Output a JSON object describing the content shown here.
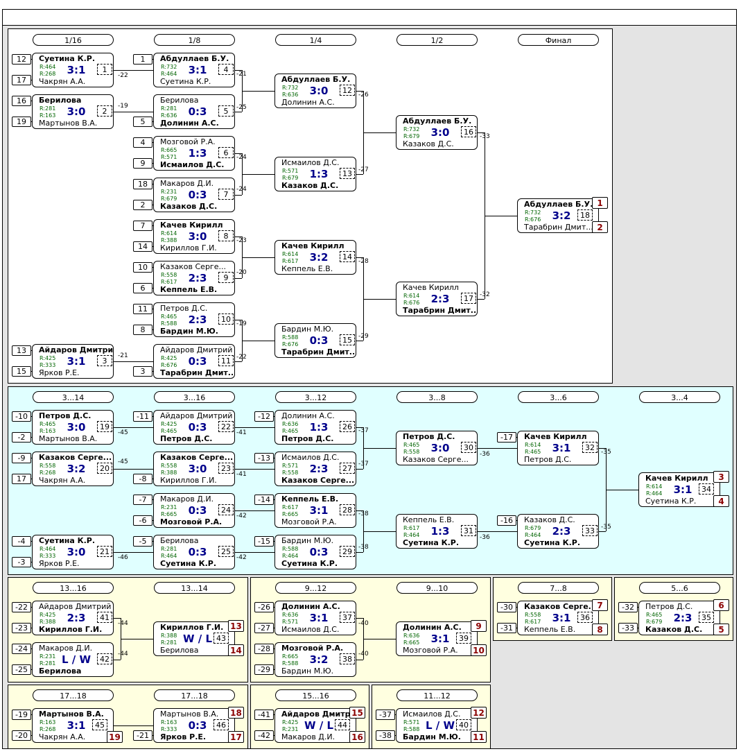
{
  "rounds": {
    "r16": "1/16",
    "r8": "1/8",
    "r4": "1/4",
    "r2": "1/2",
    "final": "Финал",
    "c3_14": "3...14",
    "c3_16": "3...16",
    "c3_12": "3...12",
    "c3_8": "3...8",
    "c3_6": "3...6",
    "c3_4": "3...4",
    "c13_16": "13...16",
    "c13_14": "13...14",
    "c9_12": "9...12",
    "c9_10": "9...10",
    "c7_8": "7...8",
    "c5_6": "5...6",
    "c17_18a": "17...18",
    "c17_18b": "17...18",
    "c15_16": "15...16",
    "c11_12": "11...12"
  },
  "matches": [
    {
      "id": "m1",
      "p1": "Суетина К.Р.",
      "r1": "R:464",
      "p2": "Чакрян А.А.",
      "r2": "R:268",
      "score": "3:1",
      "num": "1",
      "win": 1
    },
    {
      "id": "m2",
      "p1": "Берилова",
      "r1": "R:281",
      "p2": "Мартынов В.А.",
      "r2": "R:163",
      "score": "3:0",
      "num": "2",
      "win": 1
    },
    {
      "id": "m3",
      "p1": "Айдаров Дмитрий",
      "r1": "R:425",
      "p2": "Ярков Р.Е.",
      "r2": "R:333",
      "score": "3:1",
      "num": "3",
      "win": 1
    },
    {
      "id": "m4",
      "p1": "Абдуллаев Б.У.",
      "r1": "R:732",
      "p2": "Суетина К.Р.",
      "r2": "R:464",
      "score": "3:1",
      "num": "4",
      "win": 1
    },
    {
      "id": "m5",
      "p1": "Берилова",
      "r1": "R:281",
      "p2": "Долинин А.С.",
      "r2": "R:636",
      "score": "0:3",
      "num": "5",
      "win": 2
    },
    {
      "id": "m6",
      "p1": "Мозговой Р.А.",
      "r1": "R:665",
      "p2": "Исмаилов Д.С.",
      "r2": "R:571",
      "score": "1:3",
      "num": "6",
      "win": 2
    },
    {
      "id": "m7",
      "p1": "Макаров Д.И.",
      "r1": "R:231",
      "p2": "Казаков Д.С.",
      "r2": "R:679",
      "score": "0:3",
      "num": "7",
      "win": 2
    },
    {
      "id": "m8",
      "p1": "Качев Кирилл",
      "r1": "R:614",
      "p2": "Кириллов Г.И.",
      "r2": "R:388",
      "score": "3:0",
      "num": "8",
      "win": 1
    },
    {
      "id": "m9",
      "p1": "Казаков Серге...",
      "r1": "R:558",
      "p2": "Кеппель Е.В.",
      "r2": "R:617",
      "score": "2:3",
      "num": "9",
      "win": 2
    },
    {
      "id": "m10",
      "p1": "Петров Д.С.",
      "r1": "R:465",
      "p2": "Бардин М.Ю.",
      "r2": "R:588",
      "score": "2:3",
      "num": "10",
      "win": 2
    },
    {
      "id": "m11",
      "p1": "Айдаров Дмитрий",
      "r1": "R:425",
      "p2": "Тарабрин Дмит...",
      "r2": "R:676",
      "score": "0:3",
      "num": "11",
      "win": 2
    },
    {
      "id": "m12",
      "p1": "Абдуллаев Б.У.",
      "r1": "R:732",
      "p2": "Долинин А.С.",
      "r2": "R:636",
      "score": "3:0",
      "num": "12",
      "win": 1
    },
    {
      "id": "m13",
      "p1": "Исмаилов Д.С.",
      "r1": "R:571",
      "p2": "Казаков Д.С.",
      "r2": "R:679",
      "score": "1:3",
      "num": "13",
      "win": 2
    },
    {
      "id": "m14",
      "p1": "Качев Кирилл",
      "r1": "R:614",
      "p2": "Кеппель Е.В.",
      "r2": "R:617",
      "score": "3:2",
      "num": "14",
      "win": 1
    },
    {
      "id": "m15",
      "p1": "Бардин М.Ю.",
      "r1": "R:588",
      "p2": "Тарабрин Дмит...",
      "r2": "R:676",
      "score": "0:3",
      "num": "15",
      "win": 2
    },
    {
      "id": "m16",
      "p1": "Абдуллаев Б.У.",
      "r1": "R:732",
      "p2": "Казаков Д.С.",
      "r2": "R:679",
      "score": "3:0",
      "num": "16",
      "win": 1
    },
    {
      "id": "m17",
      "p1": "Качев Кирилл",
      "r1": "R:614",
      "p2": "Тарабрин Дмит...",
      "r2": "R:676",
      "score": "2:3",
      "num": "17",
      "win": 2
    },
    {
      "id": "m18",
      "p1": "Абдуллаев Б.У.",
      "r1": "R:732",
      "p2": "Тарабрин Дмит...",
      "r2": "R:676",
      "score": "3:2",
      "num": "18",
      "win": 1,
      "pl1": "1",
      "pl2": "2"
    },
    {
      "id": "m19",
      "p1": "Петров Д.С.",
      "r1": "R:465",
      "p2": "Мартынов В.А.",
      "r2": "R:163",
      "score": "3:0",
      "num": "19",
      "win": 1
    },
    {
      "id": "m20",
      "p1": "Казаков Серге...",
      "r1": "R:558",
      "p2": "Чакрян А.А.",
      "r2": "R:268",
      "score": "3:2",
      "num": "20",
      "win": 1
    },
    {
      "id": "m21",
      "p1": "Суетина К.Р.",
      "r1": "R:464",
      "p2": "Ярков Р.Е.",
      "r2": "R:333",
      "score": "3:0",
      "num": "21",
      "win": 1
    },
    {
      "id": "m22",
      "p1": "Айдаров Дмитрий",
      "r1": "R:425",
      "p2": "Петров Д.С.",
      "r2": "R:465",
      "score": "0:3",
      "num": "22",
      "win": 2
    },
    {
      "id": "m23",
      "p1": "Казаков Серге...",
      "r1": "R:558",
      "p2": "Кириллов Г.И.",
      "r2": "R:388",
      "score": "3:0",
      "num": "23",
      "win": 1
    },
    {
      "id": "m24",
      "p1": "Макаров Д.И.",
      "r1": "R:231",
      "p2": "Мозговой Р.А.",
      "r2": "R:665",
      "score": "0:3",
      "num": "24",
      "win": 2
    },
    {
      "id": "m25",
      "p1": "Берилова",
      "r1": "R:281",
      "p2": "Суетина К.Р.",
      "r2": "R:464",
      "score": "0:3",
      "num": "25",
      "win": 2
    },
    {
      "id": "m26",
      "p1": "Долинин А.С.",
      "r1": "R:636",
      "p2": "Петров Д.С.",
      "r2": "R:465",
      "score": "1:3",
      "num": "26",
      "win": 2
    },
    {
      "id": "m27",
      "p1": "Исмаилов Д.С.",
      "r1": "R:571",
      "p2": "Казаков Серге...",
      "r2": "R:558",
      "score": "2:3",
      "num": "27",
      "win": 2
    },
    {
      "id": "m28",
      "p1": "Кеппель Е.В.",
      "r1": "R:617",
      "p2": "Мозговой Р.А.",
      "r2": "R:665",
      "score": "3:1",
      "num": "28",
      "win": 1
    },
    {
      "id": "m29",
      "p1": "Бардин М.Ю.",
      "r1": "R:588",
      "p2": "Суетина К.Р.",
      "r2": "R:464",
      "score": "0:3",
      "num": "29",
      "win": 2
    },
    {
      "id": "m30",
      "p1": "Петров Д.С.",
      "r1": "R:465",
      "p2": "Казаков Серге...",
      "r2": "R:558",
      "score": "3:0",
      "num": "30",
      "win": 1
    },
    {
      "id": "m31",
      "p1": "Кеппель Е.В.",
      "r1": "R:617",
      "p2": "Суетина К.Р.",
      "r2": "R:464",
      "score": "1:3",
      "num": "31",
      "win": 2
    },
    {
      "id": "m32",
      "p1": "Качев Кирилл",
      "r1": "R:614",
      "p2": "Петров Д.С.",
      "r2": "R:465",
      "score": "3:1",
      "num": "32",
      "win": 1
    },
    {
      "id": "m33",
      "p1": "Казаков Д.С.",
      "r1": "R:679",
      "p2": "Суетина К.Р.",
      "r2": "R:464",
      "score": "2:3",
      "num": "33",
      "win": 2
    },
    {
      "id": "m34",
      "p1": "Качев Кирилл",
      "r1": "R:614",
      "p2": "Суетина К.Р.",
      "r2": "R:464",
      "score": "3:1",
      "num": "34",
      "win": 1,
      "pl1": "3",
      "pl2": "4"
    },
    {
      "id": "m41",
      "p1": "Айдаров Дмитрий",
      "r1": "R:425",
      "p2": "Кириллов Г.И.",
      "r2": "R:388",
      "score": "2:3",
      "num": "41",
      "win": 2
    },
    {
      "id": "m42",
      "p1": "Макаров Д.И.",
      "r1": "R:231",
      "p2": "Берилова",
      "r2": "R:281",
      "score": "L / W",
      "num": "42",
      "win": 2
    },
    {
      "id": "m43",
      "p1": "Кириллов Г.И.",
      "r1": "R:388",
      "p2": "Берилова",
      "r2": "R:281",
      "score": "W / L",
      "num": "43",
      "win": 1,
      "pl1": "13",
      "pl2": "14"
    },
    {
      "id": "m37",
      "p1": "Долинин А.С.",
      "r1": "R:636",
      "p2": "Исмаилов Д.С.",
      "r2": "R:571",
      "score": "3:1",
      "num": "37",
      "win": 1
    },
    {
      "id": "m38",
      "p1": "Мозговой Р.А.",
      "r1": "R:665",
      "p2": "Бардин М.Ю.",
      "r2": "R:588",
      "score": "3:2",
      "num": "38",
      "win": 1
    },
    {
      "id": "m39",
      "p1": "Долинин А.С.",
      "r1": "R:636",
      "p2": "Мозговой Р.А.",
      "r2": "R:665",
      "score": "3:1",
      "num": "39",
      "win": 1,
      "pl1": "9",
      "pl2": "10"
    },
    {
      "id": "m36",
      "p1": "Казаков Серге...",
      "r1": "R:558",
      "p2": "Кеппель Е.В.",
      "r2": "R:617",
      "score": "3:1",
      "num": "36",
      "win": 1,
      "pl1": "7",
      "pl2": "8"
    },
    {
      "id": "m35",
      "p1": "Петров Д.С.",
      "r1": "R:465",
      "p2": "Казаков Д.С.",
      "r2": "R:679",
      "score": "2:3",
      "num": "35",
      "win": 2,
      "pl1": "6",
      "pl2": "5"
    },
    {
      "id": "m45",
      "p1": "Мартынов В.А.",
      "r1": "R:163",
      "p2": "Чакрян А.А.",
      "r2": "R:268",
      "score": "3:1",
      "num": "45",
      "win": 1,
      "pl2": "19"
    },
    {
      "id": "m46",
      "p1": "Мартынов В.А.",
      "r1": "R:163",
      "p2": "Ярков Р.Е.",
      "r2": "R:333",
      "score": "0:3",
      "num": "46",
      "win": 2,
      "pl1": "18",
      "pl2": "17"
    },
    {
      "id": "m44",
      "p1": "Айдаров Дмитрий",
      "r1": "R:425",
      "p2": "Макаров Д.И.",
      "r2": "R:231",
      "score": "W / L",
      "num": "44",
      "win": 1,
      "pl1": "15",
      "pl2": "16"
    },
    {
      "id": "m40",
      "p1": "Исмаилов Д.С.",
      "r1": "R:571",
      "p2": "Бардин М.Ю.",
      "r2": "R:588",
      "score": "L / W",
      "num": "40",
      "win": 2,
      "pl1": "12",
      "pl2": "11"
    }
  ],
  "seeds": [
    "12",
    "17",
    "16",
    "19",
    "13",
    "15",
    "1",
    "5",
    "4",
    "9",
    "18",
    "2",
    "7",
    "14",
    "10",
    "6",
    "11",
    "8",
    "3",
    "-10",
    "-2",
    "-9",
    "17",
    "-4",
    "-3",
    "-11",
    "-8",
    "-7",
    "-6",
    "-5",
    "-12",
    "-13",
    "-14",
    "-15",
    "-17",
    "-16",
    "-22",
    "-23",
    "-24",
    "-25",
    "-26",
    "-27",
    "-28",
    "-29",
    "-30",
    "-31",
    "-32",
    "-33",
    "-19",
    "-20",
    "-21",
    "-41",
    "-42",
    "-37",
    "-38"
  ],
  "labels": [
    "-22",
    "-19",
    "-21",
    "-21",
    "-25",
    "-24",
    "-24",
    "-23",
    "-20",
    "-19",
    "-22",
    "-26",
    "-27",
    "-28",
    "-29",
    "-33",
    "-32",
    "-45",
    "-45",
    "-46",
    "-41",
    "-41",
    "-42",
    "-42",
    "-37",
    "-37",
    "-38",
    "-38",
    "-36",
    "-36",
    "-35",
    "-35",
    "-44",
    "-44",
    "-40",
    "-40"
  ]
}
